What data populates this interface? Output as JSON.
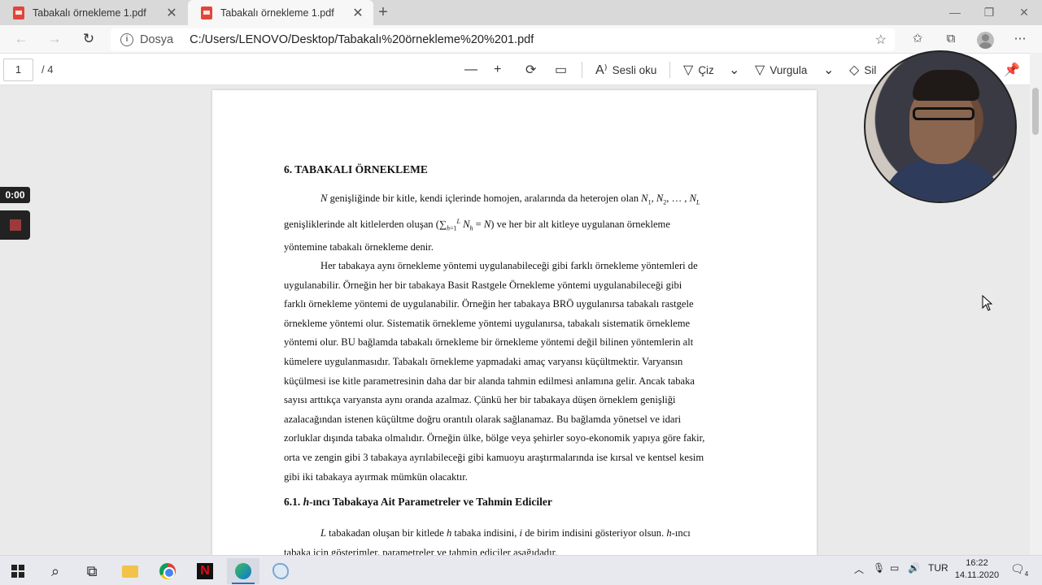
{
  "browser": {
    "tabs": [
      {
        "title": "Tabakalı örnekleme 1.pdf",
        "active": false
      },
      {
        "title": "Tabakalı örnekleme 1.pdf",
        "active": true
      }
    ],
    "new_tab_glyph": "+",
    "window_controls": {
      "minimize": "—",
      "restore": "❐",
      "close": "✕"
    },
    "address": {
      "security_label": "Dosya",
      "url": "C:/Users/LENOVO/Desktop/Tabakalı%20örnekleme%20%201.pdf"
    }
  },
  "pdf_toolbar": {
    "page_number": "1",
    "page_total": "/ 4",
    "read_aloud": "Sesli oku",
    "draw": "Çiz",
    "highlight": "Vurgula",
    "erase": "Sil"
  },
  "recorder": {
    "timer": "0:00"
  },
  "document": {
    "heading": "6. TABAKALI ÖRNEKLEME",
    "para1_lines": [
      "genişliğinde bir kitle, kendi içlerinde homojen, aralarında da heterojen olan",
      "genişliklerinde alt kitlelerden oluşan",
      "ve her bir alt kitleye uygulanan örnekleme",
      "yöntemine tabakalı örnekleme denir."
    ],
    "para2_lines": [
      "Her tabakaya aynı örnekleme yöntemi uygulanabileceği gibi farklı örnekleme yöntemleri de",
      "uygulanabilir. Örneğin her bir tabakaya Basit Rastgele Örnekleme yöntemi uygulanabileceği gibi",
      "farklı örnekleme yöntemi de uygulanabilir. Örneğin her tabakaya BRÖ uygulanırsa tabakalı rastgele",
      "örnekleme yöntemi olur. Sistematik örnekleme yöntemi uygulanırsa, tabakalı sistematik örnekleme",
      "yöntemi olur. BU bağlamda tabakalı örnekleme bir örnekleme yöntemi değil bilinen yöntemlerin alt",
      "kümelere uygulanmasıdır. Tabakalı örnekleme yapmadaki amaç varyansı küçültmektir. Varyansın",
      "küçülmesi ise kitle parametresinin daha dar bir alanda tahmin edilmesi anlamına gelir. Ancak tabaka",
      "sayısı arttıkça varyansta aynı oranda azalmaz. Çünkü her bir tabakaya düşen örneklem genişliği",
      "azalacağından istenen küçültme doğru orantılı olarak sağlanamaz. Bu bağlamda yönetsel ve idari",
      "zorluklar dışında tabaka olmalıdır. Örneğin ülke, bölge veya şehirler soyo-ekonomik yapıya göre fakir,",
      "orta ve zengin gibi 3 tabakaya ayrılabileceği gibi kamuoyu araştırmalarında ise kırsal ve kentsel kesim",
      "gibi iki tabakaya ayırmak mümkün olacaktır."
    ],
    "subheading_prefix": "6.1.",
    "subheading_rest": "-ıncı Tabakaya Ait Parametreler ve Tahmin Ediciler",
    "para3_lines": [
      "tabakadan oluşan bir kitlede",
      "tabaka indisini,",
      "de birim indisini gösteriyor olsun.",
      "-ıncı",
      "tabaka için gösterimler, parametreler ve tahmin ediciler aşağıdadır."
    ]
  },
  "taskbar": {
    "language": "TUR",
    "time": "16:22",
    "date": "14.11.2020",
    "notification_count": "4"
  }
}
